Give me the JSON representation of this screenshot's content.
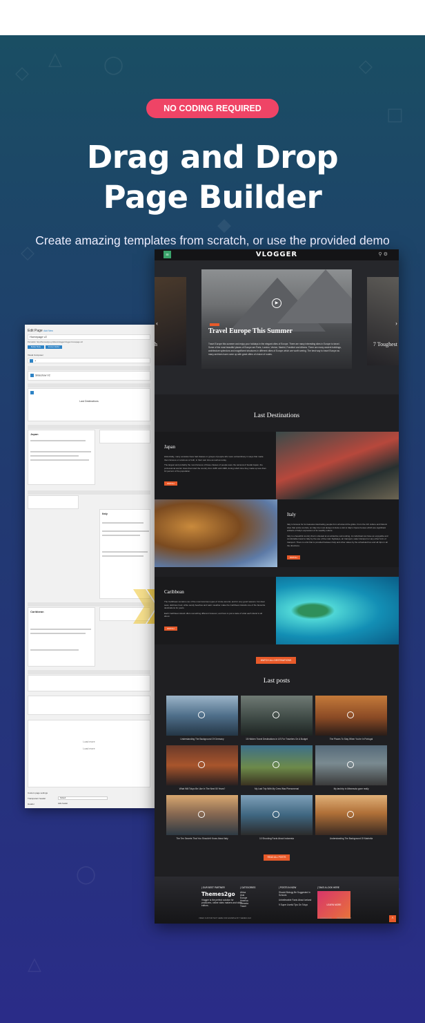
{
  "badge": "NO CODING REQUIRED",
  "title_line1": "Drag and Drop",
  "title_line2": "Page Builder",
  "subtitle": "Create amazing templates from scratch, or use the provided demo",
  "colors": {
    "accent": "#ef4466",
    "site_accent": "#e85a2a",
    "bg_top": "#1a4e63",
    "bg_bottom": "#2a2c88"
  },
  "editor": {
    "heading": "Edit Page",
    "add_new": "Add New",
    "page_title": "Homepage v2",
    "permalink": "Permalink: http://themes2go.xyz/demo/vlogger/vlogger-homepage-v2/",
    "btn_builder": "Builder Mode",
    "btn_frontend": "Frontend Editor",
    "builder_title": "Visual Composer",
    "labels": [
      "Slideshow V2",
      "Row",
      "Last Destinations",
      "Japan",
      "Italy",
      "Caribbean",
      "Section",
      "Button",
      "Post Grid",
      "Load more",
      "Load more"
    ],
    "dest_label": "Last Destinations",
    "japan_label": "Japan",
    "italy_label": "Italy",
    "caribbean_label": "Caribbean",
    "page_settings": "Custom page settings",
    "transparent_header": "Transparent header",
    "transparent_value": "Default",
    "header_label": "Header",
    "header_value": "Hide header",
    "footer_note": "Thank you for creating with WordPress."
  },
  "site": {
    "logo": "VLOGGER",
    "nav_icons": "⚲  ⚙",
    "slide_title": "Travel Europe This Summer",
    "slide_text": "Travel Europe this summer and enjoy your holidays in the elegant cities of Europe. There are many interesting sites in Europe to travel. Some of the most beautiful places of Europe are Paris, London, Venice, Madrid, Frankfurt and Athens. There are many ancient buildings, architecture splendors and magnificent structures in different cities of Europe which are worth seeing. The best way to travel Europe as many archives have come up with great offers of choice of routes.",
    "side_slide_left": "h",
    "side_slide_right": "7 Toughest",
    "dest_title": "Last Destinations",
    "destinations": [
      {
        "name": "Japan",
        "text1": "Historically, many societies have had classes or groups of people who were extraordinary in ways that made them famous or notorious or both, in their own time as well as today.",
        "text2": "The largest and probably the most famous of these classes of people were the samurai of feudal Japan, the professional warrior class that ruled the country from 1185 until 1868, during which time they made up less than 10 percent of the population.",
        "btn": "WATCH"
      },
      {
        "name": "Italy",
        "text1": "Italy is famous for its treasures fascinating people from all around the globe. From the rich culture and historic sites that entice tourists, an Italy trip must always include a visit to Italy's Opera houses which are significant artifacts of Italy's expression of its wealthy culture.",
        "text2": "Italy is a beautiful country that is situated at an attractive surrounding. An individual can have an enjoyable and comfortable travel to Italy by the use of the main highways, air transport, water transport or any other form of transport. There is a list that is provided between Italy and other states by the scheduled bus and all trips in all the directions.",
        "btn": "WATCH"
      },
      {
        "name": "Caribbean",
        "text1": "The Caribbean remains one of the most luxurious types of cruise around, and for very good reasons: hot clear seas, delicious food, white sandy beaches and warm weather make the Caribbean Islands one of the favourite destinations for years.",
        "text2": "Each Caribbean island offers something different however, and here is just a taste of what each island is all about.",
        "btn": "WATCH"
      }
    ],
    "btn_all_dest": "WATCH ALL DESTINATIONS",
    "posts_title": "Last posts",
    "posts": [
      "Understanding The Background Of Germany",
      "15 Hidden Travel Destinations In US For Travelers On A Budget",
      "The Places To Stay When You're In Portugal",
      "What Will Tokyo Be Like In The Next 50 Years?",
      "My Last Trip With My Crew Was Phenomenal",
      "My last trip in Minnesota gone really",
      "The Ten Secrets That You Shouldn't Know About Italy",
      "10 Shocking Facts About Indonesia",
      "Understanding The Background Of Marbella"
    ],
    "btn_all_posts": "READ ALL POSTS",
    "footer": {
      "col1_head": "| OUR BEST PARTNER",
      "brand": "Themes2go",
      "col1_text": "Vlogger is the perfect solution for producers, online video makers and video editors.",
      "col2_head": "| CATEGORIES",
      "col2_items": [
        "Africa",
        "Asia",
        "Europe",
        "America",
        "Oceania",
        "Travel"
      ],
      "col3_head": "| POSTS IN NOW",
      "col3_items": [
        "Should Biology Be Suggested In Schools",
        "Unbelievable Facts About Iceland",
        "9 Super Useful Tips On Tokyo"
      ],
      "col4_head": "| TAKE A LOOK HERE",
      "promo": "LEARN MORE",
      "bottom_left": "VIDEO CUSTOM TEXT HERE FOR EXAMPLE BY THEMES 2GO",
      "bottom_right1": "CONTACT US",
      "bottom_right2": "PRIVACY POLICY",
      "totop": "^"
    }
  }
}
